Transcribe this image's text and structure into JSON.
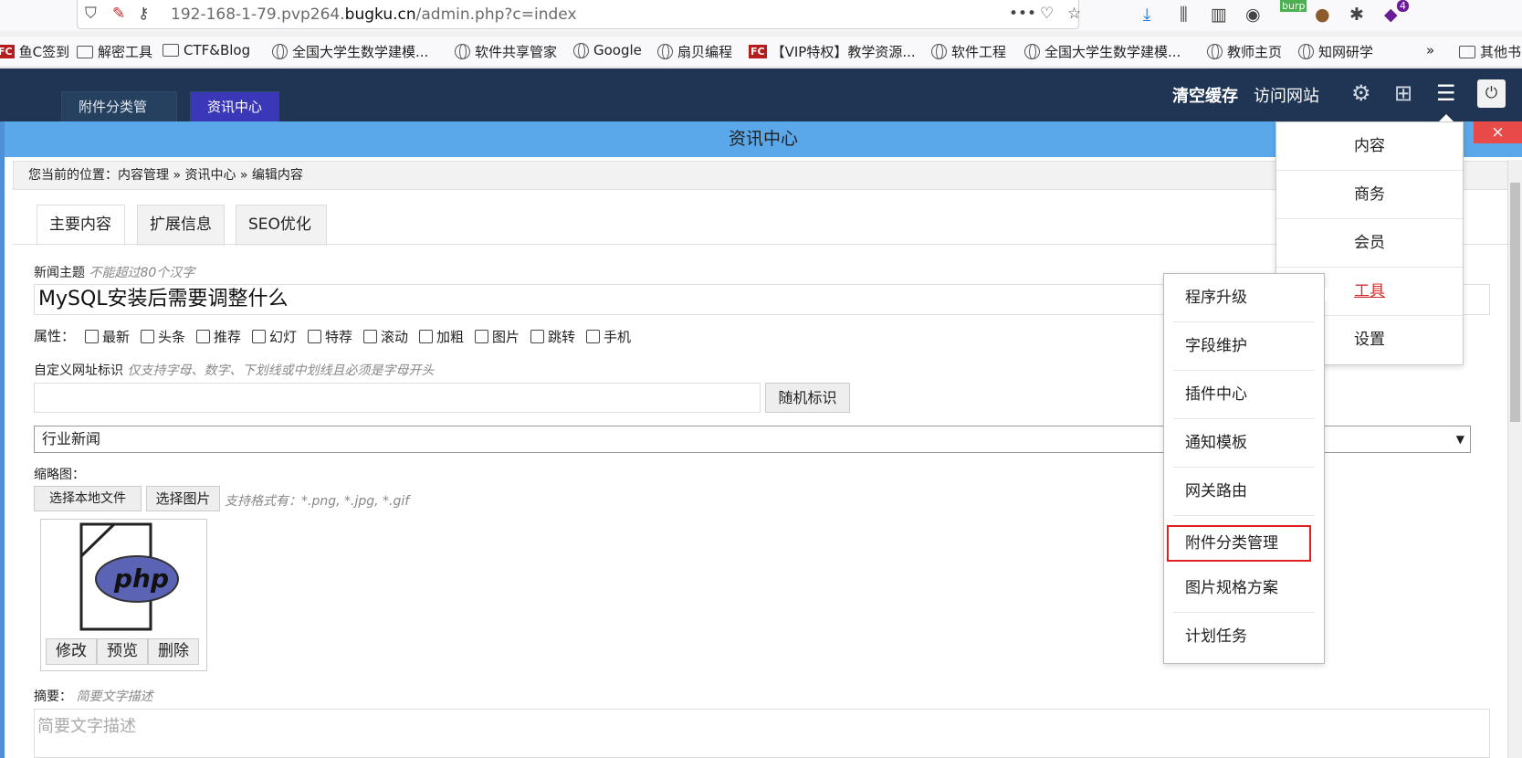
{
  "browser": {
    "url_prefix": "192-168-1-79.pvp264.",
    "url_domain": "bugku.cn",
    "url_path": "/admin.php?c=index",
    "bookmarks": [
      "鱼C签到",
      "解密工具",
      "CTF&Blog",
      "全国大学生数学建模...",
      "软件共享管家",
      "Google",
      "扇贝编程",
      "【VIP特权】教学资源...",
      "软件工程",
      "全国大学生数学建模...",
      "教师主页",
      "知网研学",
      "其他书"
    ],
    "extension_badge": "burp",
    "extension_count": "4",
    "fc_badge": "FC"
  },
  "admin": {
    "tabs": [
      "附件分类管理",
      "资讯中心"
    ],
    "clear_cache": "清空缓存",
    "visit_site": "访问网站"
  },
  "window": {
    "title": "资讯中心",
    "close": "×",
    "breadcrumb": "您当前的位置：内容管理 » 资讯中心 » 编辑内容",
    "tabs": [
      "主要内容",
      "扩展信息",
      "SEO优化"
    ]
  },
  "form": {
    "title_label": "新闻主题",
    "title_hint": "不能超过80个汉字",
    "title_value": "MySQL安装后需要调整什么",
    "attr_label": "属性：",
    "attrs": [
      "最新",
      "头条",
      "推荐",
      "幻灯",
      "特荐",
      "滚动",
      "加粗",
      "图片",
      "跳转",
      "手机"
    ],
    "url_label": "自定义网址标识",
    "url_hint": "仅支持字母、数字、下划线或中划线且必须是字母开头",
    "random_btn": "随机标识",
    "category": "行业新闻",
    "thumb_label": "缩略图：",
    "local_btn": "选择本地文件",
    "pick_btn": "选择图片",
    "format_hint": "支持格式有：*.png, *.jpg, *.gif",
    "thumb_actions": [
      "修改",
      "预览",
      "删除"
    ],
    "summary_label": "摘要：",
    "summary_hint": "简要文字描述",
    "summary_placeholder": "简要文字描述"
  },
  "menu_main": [
    "内容",
    "商务",
    "会员",
    "工具",
    "设置"
  ],
  "menu_tools": [
    "程序升级",
    "字段维护",
    "插件中心",
    "通知模板",
    "网关路由",
    "附件分类管理",
    "图片规格方案",
    "计划任务"
  ]
}
